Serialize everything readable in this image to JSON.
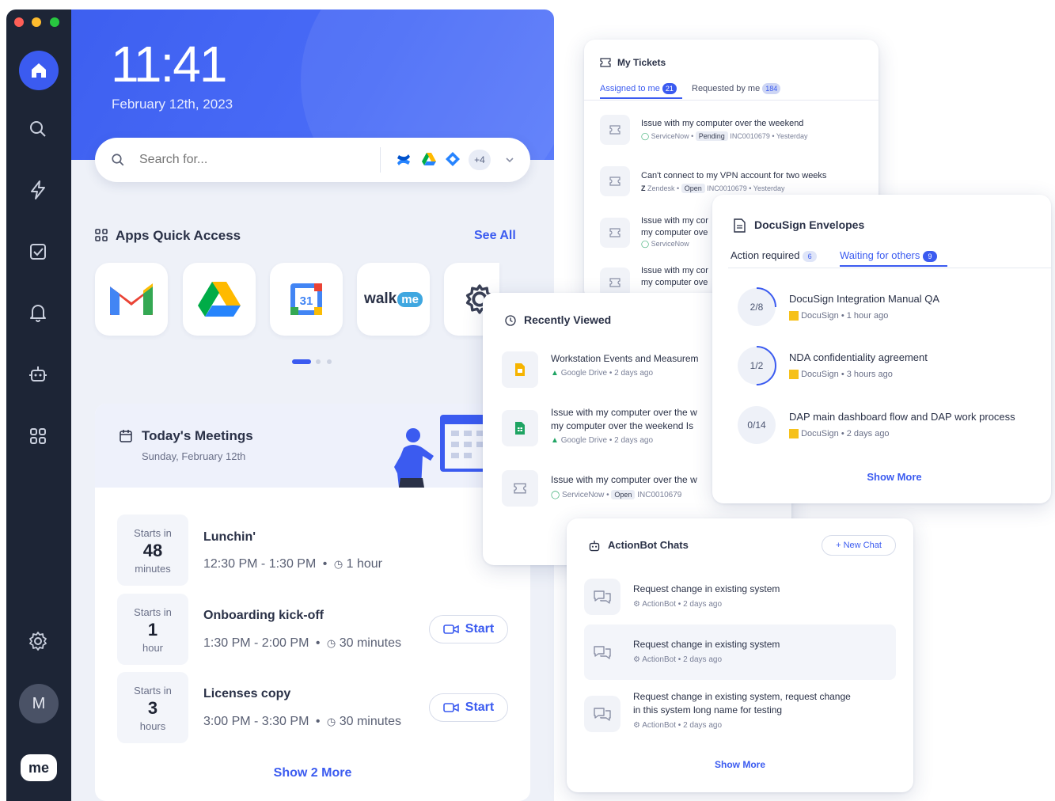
{
  "main": {
    "clock": "11:41",
    "date": "February 12th, 2023",
    "search": {
      "placeholder": "Search for...",
      "more_count": "+4"
    },
    "apps": {
      "title": "Apps Quick Access",
      "see_all": "See All",
      "tiles": [
        "gmail-icon",
        "google-drive-icon",
        "google-calendar-icon",
        "walkme-icon",
        "settings-app-icon"
      ],
      "calendar_day": "31",
      "walkme_text": "walk",
      "walkme_badge": "me"
    },
    "meetings": {
      "title": "Today's Meetings",
      "subtitle": "Sunday, February 12th",
      "items": [
        {
          "starts_label": "Starts in",
          "starts_value": "48",
          "starts_unit": "minutes",
          "title": "Lunchin'",
          "time": "12:30 PM - 1:30 PM",
          "duration": "1 hour",
          "has_start": false
        },
        {
          "starts_label": "Starts in",
          "starts_value": "1",
          "starts_unit": "hour",
          "title": "Onboarding kick-off",
          "time": "1:30 PM - 2:00 PM",
          "duration": "30 minutes",
          "has_start": true
        },
        {
          "starts_label": "Starts in",
          "starts_value": "3",
          "starts_unit": "hours",
          "title": "Licenses copy",
          "time": "3:00 PM - 3:30 PM",
          "duration": "30 minutes",
          "has_start": true
        }
      ],
      "start_label": "Start",
      "show_more": "Show 2 More"
    },
    "sidebar_avatar": "M",
    "logo_text": "me"
  },
  "tickets": {
    "title": "My Tickets",
    "tabs": [
      {
        "label": "Assigned to me",
        "count": "21"
      },
      {
        "label": "Requested by me",
        "count": "184"
      }
    ],
    "items": [
      {
        "title": "Issue with my computer over the weekend",
        "source": "ServiceNow",
        "status": "Pending",
        "id": "INC0010679",
        "when": "Yesterday"
      },
      {
        "title": "Can't connect to my VPN account for two weeks",
        "source": "Zendesk",
        "status": "Open",
        "id": "INC0010679",
        "when": "Yesterday"
      },
      {
        "title": "Issue with my cor",
        "title2": "my computer ove",
        "source": "ServiceNow",
        "status": "",
        "id": "",
        "when": ""
      },
      {
        "title": "Issue with my cor",
        "title2": "my computer ove",
        "source": "",
        "status": "",
        "id": "",
        "when": ""
      }
    ]
  },
  "docusign": {
    "title": "DocuSign Envelopes",
    "tabs": [
      {
        "label": "Action required",
        "count": "6"
      },
      {
        "label": "Waiting for others",
        "count": "9"
      }
    ],
    "items": [
      {
        "progress": "2/8",
        "fraction": 0.25,
        "title": "DocuSign Integration Manual QA",
        "source": "DocuSign",
        "when": "1 hour ago"
      },
      {
        "progress": "1/2",
        "fraction": 0.5,
        "title": "NDA confidentiality agreement",
        "source": "DocuSign",
        "when": "3 hours ago"
      },
      {
        "progress": "0/14",
        "fraction": 0,
        "title": "DAP main dashboard flow and DAP work process",
        "source": "DocuSign",
        "when": "2 days ago"
      }
    ],
    "show_more": "Show More"
  },
  "recent": {
    "title": "Recently Viewed",
    "items": [
      {
        "title": "Workstation Events and Measurem",
        "title2": "",
        "source": "Google Drive",
        "when": "2 days ago",
        "color": "#f6b400"
      },
      {
        "title": "Issue with my computer over the w",
        "title2": "my computer over the weekend Is",
        "source": "Google Drive",
        "when": "2 days ago",
        "color": "#1fa463"
      },
      {
        "title": "Issue with my computer over the w",
        "title2": "",
        "source": "ServiceNow",
        "status": "Open",
        "id": "INC0010679",
        "color": "#e9ecf4"
      }
    ]
  },
  "chats": {
    "title": "ActionBot Chats",
    "new_chat": "New Chat",
    "items": [
      {
        "title": "Request change in existing system",
        "title2": "",
        "source": "ActionBot",
        "when": "2 days ago"
      },
      {
        "title": "Request change in existing system",
        "title2": "",
        "source": "ActionBot",
        "when": "2 days ago"
      },
      {
        "title": "Request change in existing system, request change",
        "title2": "in this system long name for testing",
        "source": "ActionBot",
        "when": "2 days ago"
      }
    ],
    "show_more": "Show More"
  },
  "colors": {
    "accent": "#3b5bf0",
    "sidebar": "#1d2536",
    "hero": "#4a6cf7",
    "docusign_yellow": "#f6c11a"
  }
}
